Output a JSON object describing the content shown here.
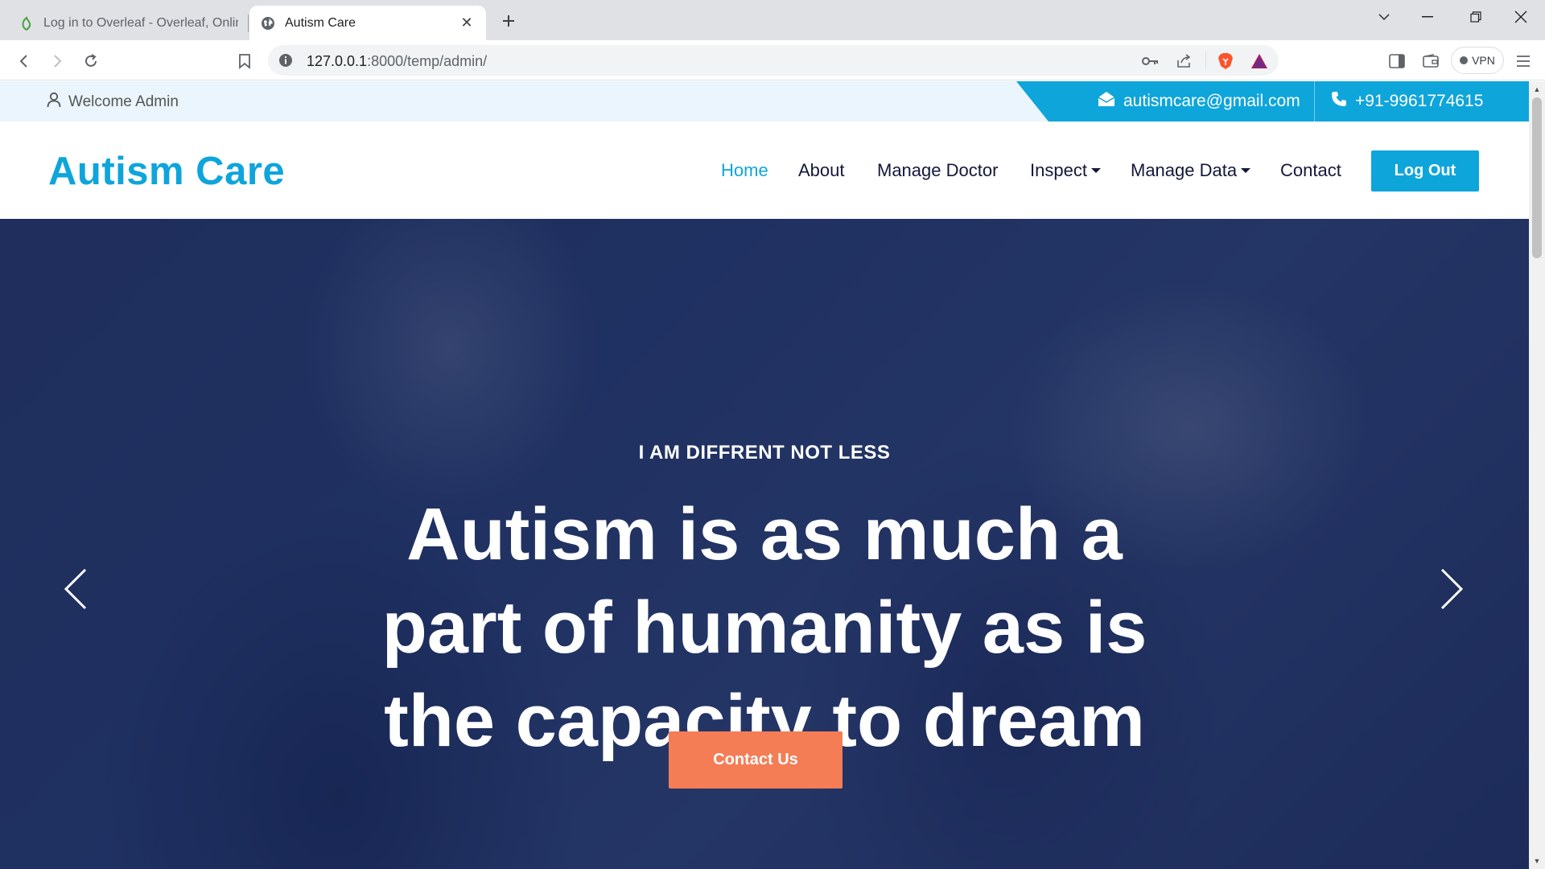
{
  "browser": {
    "tabs": [
      {
        "title": "Log in to Overleaf - Overleaf, Online",
        "active": false,
        "icon": "overleaf-leaf-icon"
      },
      {
        "title": "Autism Care",
        "active": true,
        "icon": "globe-icon"
      }
    ],
    "url": {
      "host": "127.0.0.1",
      "path": ":8000/temp/admin/"
    },
    "vpn_label": "VPN"
  },
  "topbar": {
    "welcome": "Welcome Admin",
    "email": "autismcare@gmail.com",
    "phone": "+91-9961774615"
  },
  "navbar": {
    "brand": "Autism Care",
    "links": [
      {
        "label": "Home",
        "active": true
      },
      {
        "label": "About"
      },
      {
        "label": "Manage Doctor"
      },
      {
        "label": "Inspect",
        "dropdown": true
      },
      {
        "label": "Manage Data",
        "dropdown": true
      },
      {
        "label": "Contact"
      }
    ],
    "logout": "Log Out"
  },
  "hero": {
    "subtitle": "I AM DIFFRENT NOT LESS",
    "title": "Autism is as much a part of humanity as is the capacity to dream",
    "cta": "Contact Us"
  },
  "colors": {
    "accent": "#0ea5db",
    "cta": "#f47d55",
    "nav_text": "#13183a"
  }
}
